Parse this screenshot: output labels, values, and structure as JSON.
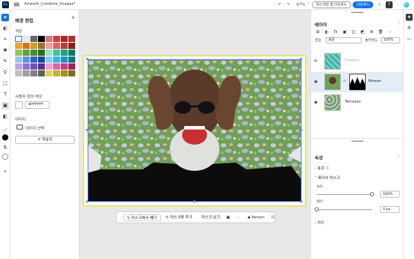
{
  "app": {
    "logo": "Ps",
    "doc_title": "Artwork_Combine_Images*"
  },
  "topbar": {
    "zoom": "67%",
    "download_label": "데스크탑 앱 다운로드",
    "share_label": "다운로드",
    "help_label": "?"
  },
  "left_panel": {
    "title": "배경 편집",
    "color_section": "색상",
    "palette": [
      "#ffffff",
      "#e6e6e6",
      "#666666",
      "#000000",
      "#c97a7a",
      "#cc3b3b",
      "#a52a2a",
      "#b03030",
      "#f0a030",
      "#e07020",
      "#c8a030",
      "#a07020",
      "#f0a0a0",
      "#e06060",
      "#b04040",
      "#902020",
      "#90c060",
      "#60a040",
      "#409030",
      "#207020",
      "#a0e0c0",
      "#40c0a0",
      "#20a080",
      "#008060",
      "#a0c0f0",
      "#6090e0",
      "#3060c0",
      "#2040a0",
      "#80d0f0",
      "#40b0e0",
      "#2090c0",
      "#107090",
      "#c0a0e0",
      "#9070d0",
      "#7050b0",
      "#503090",
      "#f0a0d0",
      "#e060a0",
      "#c04080",
      "#a02060",
      "#c0c0c0",
      "#a0a0a0",
      "#808080",
      "#606060",
      "#e0d060",
      "#c0b040",
      "#a09020",
      "#807010"
    ],
    "custom_label": "사용자 정의 색상",
    "custom_hex": "#FFFFFF",
    "image_section": "이미지",
    "image_select": "이미지 선택",
    "reset_label": "재설정"
  },
  "canvas": {
    "bottom_toolbar": {
      "subtract_label": "마스크에서 빼기",
      "add_label": "마스크에 추가",
      "view_label": "마스크 보기",
      "more_label": "···",
      "layer_label": "Person"
    }
  },
  "layers_panel": {
    "title": "레이어",
    "blend_label": "혼합",
    "blend_value": "표준",
    "opacity_label": "불투명도",
    "opacity_value": "100%",
    "layers": [
      {
        "name": "Flowers",
        "visible": false
      },
      {
        "name": "Person",
        "visible": true
      },
      {
        "name": "Terrazzo",
        "visible": true
      }
    ]
  },
  "properties_panel": {
    "title": "속성",
    "effects_label": "효과",
    "layer_mask_label": "레이어 마스크",
    "density_label": "농도",
    "density_value": "100%",
    "density_fraction": 1.0,
    "feather_label": "페더",
    "feather_value": "0 px",
    "feather_fraction": 0.0,
    "dimensions_label": "치수"
  }
}
